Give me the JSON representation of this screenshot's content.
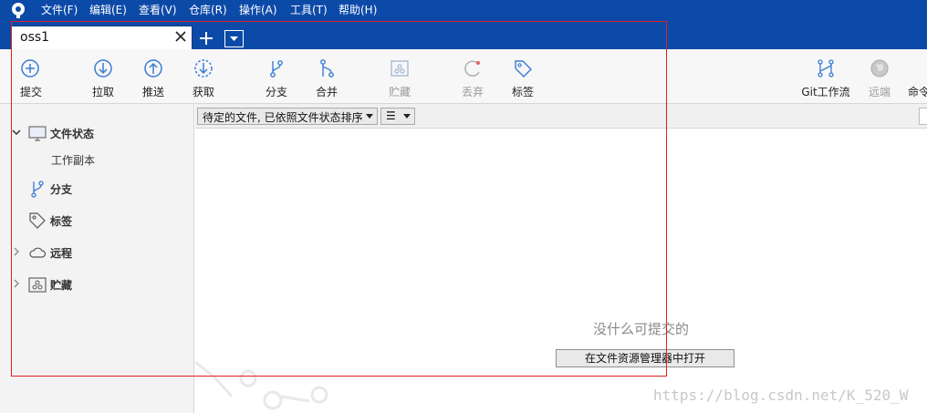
{
  "menubar": {
    "items": [
      "文件(F)",
      "编辑(E)",
      "查看(V)",
      "仓库(R)",
      "操作(A)",
      "工具(T)",
      "帮助(H)"
    ]
  },
  "tabs": {
    "active_label": "oss1"
  },
  "toolbar": {
    "commit": "提交",
    "pull": "拉取",
    "push": "推送",
    "fetch": "获取",
    "branch": "分支",
    "merge": "合并",
    "stash": "贮藏",
    "discard": "丢弃",
    "tag": "标签",
    "git_flow": "Git工作流",
    "remote": "远端",
    "terminal": "命令"
  },
  "sidebar": {
    "file_status": "文件状态",
    "working_copy": "工作副本",
    "branches": "分支",
    "tags": "标签",
    "remotes": "远程",
    "stashes": "贮藏"
  },
  "main": {
    "filter_select": "待定的文件, 已依照文件状态排序",
    "view_select": "☰",
    "empty_message": "没什么可提交的",
    "open_in_explorer": "在文件资源管理器中打开"
  },
  "watermark": "https://blog.csdn.net/K_520_W",
  "colors": {
    "menubar_bg": "#0c4aa8",
    "icon_blue": "#3a7bd5",
    "disabled": "#a0a0a0",
    "annotation_red": "#e02020"
  }
}
